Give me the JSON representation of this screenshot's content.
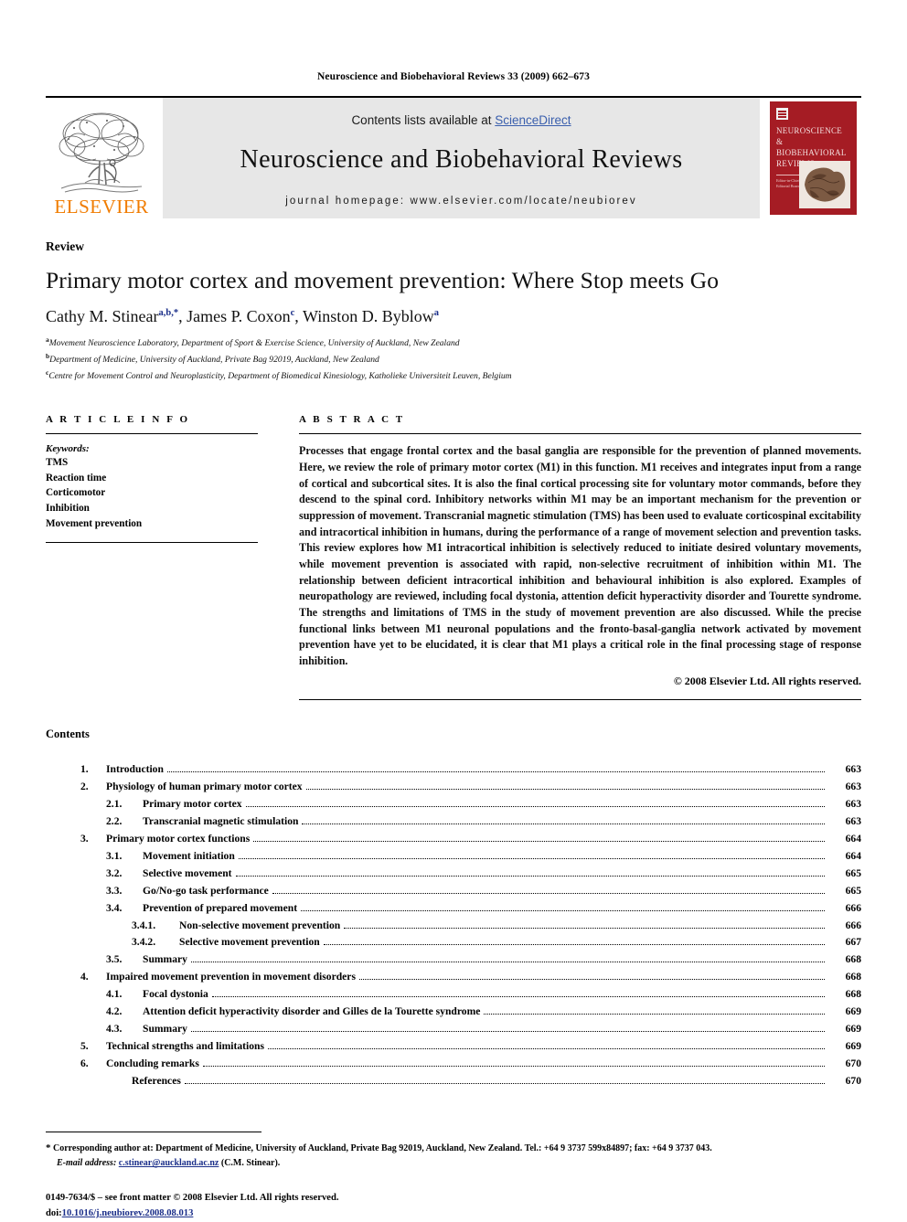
{
  "running_head": "Neuroscience and Biobehavioral Reviews 33 (2009) 662–673",
  "masthead": {
    "publisher_name": "ELSEVIER",
    "contents_prefix": "Contents lists available at ",
    "sciencedirect": "ScienceDirect",
    "journal_title": "Neuroscience and Biobehavioral Reviews",
    "homepage": "journal homepage: www.elsevier.com/locate/neubiorev",
    "cover": {
      "title_line1": "NEUROSCIENCE",
      "title_line2": "& BIOBEHAVIORAL",
      "title_line3": "REVIEWS",
      "editors": "Editor-in-Chief\nMary E. Harrington\nwith Editorial Board"
    },
    "accent_orange": "#F07C00",
    "link_blue": "#3a5fad",
    "band_gray": "#e7e7e7",
    "cover_red": "#a51c24"
  },
  "article": {
    "type_label": "Review",
    "title": "Primary motor cortex and movement prevention: Where Stop meets Go",
    "authors": [
      {
        "name": "Cathy M. Stinear",
        "sup": "a,b,*"
      },
      {
        "name": "James P. Coxon",
        "sup": "c"
      },
      {
        "name": "Winston D. Byblow",
        "sup": "a"
      }
    ],
    "affiliations": [
      {
        "mark": "a",
        "text": "Movement Neuroscience Laboratory, Department of Sport & Exercise Science, University of Auckland, New Zealand"
      },
      {
        "mark": "b",
        "text": "Department of Medicine, University of Auckland, Private Bag 92019, Auckland, New Zealand"
      },
      {
        "mark": "c",
        "text": "Centre for Movement Control and Neuroplasticity, Department of Biomedical Kinesiology, Katholieke Universiteit Leuven, Belgium"
      }
    ]
  },
  "article_info": {
    "heading": "A R T I C L E  I N F O",
    "keywords_label": "Keywords:",
    "keywords": [
      "TMS",
      "Reaction time",
      "Corticomotor",
      "Inhibition",
      "Movement prevention"
    ]
  },
  "abstract": {
    "heading": "A B S T R A C T",
    "text": "Processes that engage frontal cortex and the basal ganglia are responsible for the prevention of planned movements. Here, we review the role of primary motor cortex (M1) in this function. M1 receives and integrates input from a range of cortical and subcortical sites. It is also the final cortical processing site for voluntary motor commands, before they descend to the spinal cord. Inhibitory networks within M1 may be an important mechanism for the prevention or suppression of movement. Transcranial magnetic stimulation (TMS) has been used to evaluate corticospinal excitability and intracortical inhibition in humans, during the performance of a range of movement selection and prevention tasks. This review explores how M1 intracortical inhibition is selectively reduced to initiate desired voluntary movements, while movement prevention is associated with rapid, non-selective recruitment of inhibition within M1. The relationship between deficient intracortical inhibition and behavioural inhibition is also explored. Examples of neuropathology are reviewed, including focal dystonia, attention deficit hyperactivity disorder and Tourette syndrome. The strengths and limitations of TMS in the study of movement prevention are also discussed. While the precise functional links between M1 neuronal populations and the fronto-basal-ganglia network activated by movement prevention have yet to be elucidated, it is clear that M1 plays a critical role in the final processing stage of response inhibition.",
    "copyright": "© 2008 Elsevier Ltd. All rights reserved."
  },
  "contents": {
    "heading": "Contents",
    "entries": [
      {
        "level": 1,
        "num": "1.",
        "label": "Introduction",
        "page": "663"
      },
      {
        "level": 1,
        "num": "2.",
        "label": "Physiology of human primary motor cortex",
        "page": "663"
      },
      {
        "level": 2,
        "num": "2.1.",
        "label": "Primary motor cortex",
        "page": "663"
      },
      {
        "level": 2,
        "num": "2.2.",
        "label": "Transcranial magnetic stimulation",
        "page": "663"
      },
      {
        "level": 1,
        "num": "3.",
        "label": "Primary motor cortex functions",
        "page": "664"
      },
      {
        "level": 2,
        "num": "3.1.",
        "label": "Movement initiation",
        "page": "664"
      },
      {
        "level": 2,
        "num": "3.2.",
        "label": "Selective movement",
        "page": "665"
      },
      {
        "level": 2,
        "num": "3.3.",
        "label": "Go/No-go task performance",
        "page": "665"
      },
      {
        "level": 2,
        "num": "3.4.",
        "label": "Prevention of prepared movement",
        "page": "666"
      },
      {
        "level": 3,
        "num": "3.4.1.",
        "label": "Non-selective movement prevention",
        "page": "666"
      },
      {
        "level": 3,
        "num": "3.4.2.",
        "label": "Selective movement prevention",
        "page": "667"
      },
      {
        "level": 2,
        "num": "3.5.",
        "label": "Summary",
        "page": "668"
      },
      {
        "level": 1,
        "num": "4.",
        "label": "Impaired movement prevention in movement disorders",
        "page": "668"
      },
      {
        "level": 2,
        "num": "4.1.",
        "label": "Focal dystonia",
        "page": "668"
      },
      {
        "level": 2,
        "num": "4.2.",
        "label": "Attention deficit hyperactivity disorder and Gilles de la Tourette syndrome",
        "page": "669"
      },
      {
        "level": 2,
        "num": "4.3.",
        "label": "Summary",
        "page": "669"
      },
      {
        "level": 1,
        "num": "5.",
        "label": "Technical strengths and limitations",
        "page": "669"
      },
      {
        "level": 1,
        "num": "6.",
        "label": "Concluding remarks",
        "page": "670"
      },
      {
        "level": 0,
        "num": "",
        "label": "References",
        "page": "670"
      }
    ]
  },
  "footnote": {
    "star": "*",
    "corresponding": "Corresponding author at: Department of Medicine, University of Auckland, Private Bag 92019, Auckland, New Zealand. Tel.: +64 9 3737 599x84897; fax: +64 9 3737 043.",
    "email_label": "E-mail address:",
    "email": "c.stinear@auckland.ac.nz",
    "email_suffix": "(C.M. Stinear)."
  },
  "imprint": {
    "issn_line": "0149-7634/$ – see front matter © 2008 Elsevier Ltd. All rights reserved.",
    "doi_prefix": "doi:",
    "doi": "10.1016/j.neubiorev.2008.08.013"
  }
}
